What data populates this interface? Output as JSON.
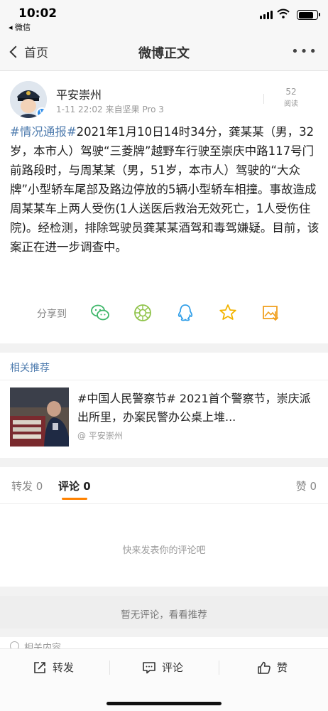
{
  "status_bar": {
    "time": "10:02",
    "back_app": "◂ 微信"
  },
  "nav": {
    "back_label": "首页",
    "title": "微博正文",
    "more_label": "•••"
  },
  "post": {
    "author": "平安崇州",
    "time": "1-11 22:02",
    "source": "来自坚果 Pro 3",
    "read_count": "52",
    "read_label": "阅读",
    "hashtag": "#情况通报#",
    "body": "2021年1月10日14时34分，龚某某（男，32岁，本市人）驾驶“三菱牌”越野车行驶至崇庆中路117号门前路段时，与周某某（男，51岁，本市人）驾驶的“大众牌”小型轿车尾部及路边停放的5辆小型轿车相撞。事故造成周某某车上两人受伤(1人送医后救治无效死亡，1人受伤住院)。经检测，排除驾驶员龚某某酒驾和毒驾嫌疑。目前，该案正在进一步调查中。",
    "share_label": "分享到"
  },
  "related": {
    "header": "相关推荐",
    "item_title": "#中国人民警察节# 2021首个警察节，崇庆派出所里，办案民警办公桌上堆...",
    "item_source": "平安崇州"
  },
  "tabs": {
    "repost": "转发 0",
    "comment": "评论 0",
    "like": "赞 0"
  },
  "comments": {
    "empty_hint": "快来发表你的评论吧",
    "no_comments": "暂无评论，看看推荐",
    "related_content": "相关内容"
  },
  "toolbar": {
    "repost": "转发",
    "comment": "评论",
    "like": "赞"
  },
  "colors": {
    "link_blue": "#507daf",
    "accent_orange": "#ff8200",
    "verified_blue": "#2b8cea"
  }
}
